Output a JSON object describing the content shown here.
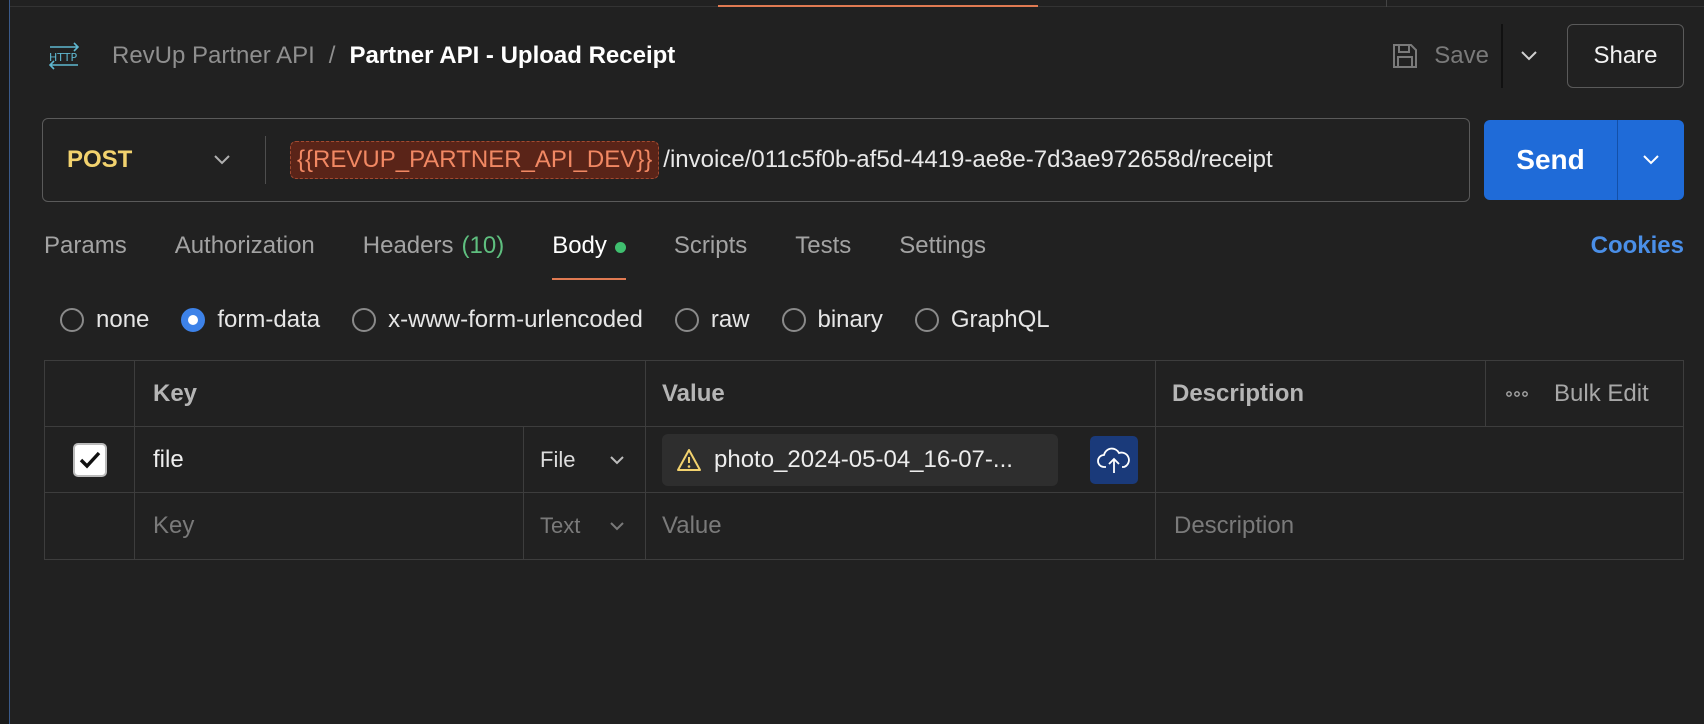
{
  "breadcrumb": {
    "collection": "RevUp Partner API",
    "separator": "/",
    "request_name": "Partner API - Upload Receipt"
  },
  "header_actions": {
    "save_label": "Save",
    "share_label": "Share"
  },
  "request": {
    "method": "POST",
    "env_variable": "{{REVUP_PARTNER_API_DEV}}",
    "path": "/invoice/011c5f0b-af5d-4419-ae8e-7d3ae972658d/receipt",
    "send_label": "Send"
  },
  "tabs": [
    {
      "label": "Params"
    },
    {
      "label": "Authorization"
    },
    {
      "label": "Headers",
      "count": "(10)"
    },
    {
      "label": "Body"
    },
    {
      "label": "Scripts"
    },
    {
      "label": "Tests"
    },
    {
      "label": "Settings"
    }
  ],
  "cookies_label": "Cookies",
  "body_types": [
    {
      "label": "none",
      "selected": false
    },
    {
      "label": "form-data",
      "selected": true
    },
    {
      "label": "x-www-form-urlencoded",
      "selected": false
    },
    {
      "label": "raw",
      "selected": false
    },
    {
      "label": "binary",
      "selected": false
    },
    {
      "label": "GraphQL",
      "selected": false
    }
  ],
  "form_table": {
    "columns": {
      "key": "Key",
      "value": "Value",
      "description": "Description",
      "bulk_edit": "Bulk Edit"
    },
    "rows": [
      {
        "checked": true,
        "key": "file",
        "type": "File",
        "value": "photo_2024-05-04_16-07-...",
        "description": ""
      }
    ],
    "new_row": {
      "key_placeholder": "Key",
      "type": "Text",
      "value_placeholder": "Value",
      "description_placeholder": "Description"
    }
  },
  "colors": {
    "accent": "#1f6bd8",
    "method": "#f2d26e",
    "env_variable": "#f18863",
    "active_tab": "#e07a52",
    "headers_count": "#5fbf7f",
    "cookies": "#4a8fe8"
  },
  "icons": [
    "http-icon",
    "save-icon",
    "chevron-down-icon",
    "warning-icon",
    "cloud-upload-icon",
    "more-dots-icon",
    "checkmark-icon"
  ]
}
